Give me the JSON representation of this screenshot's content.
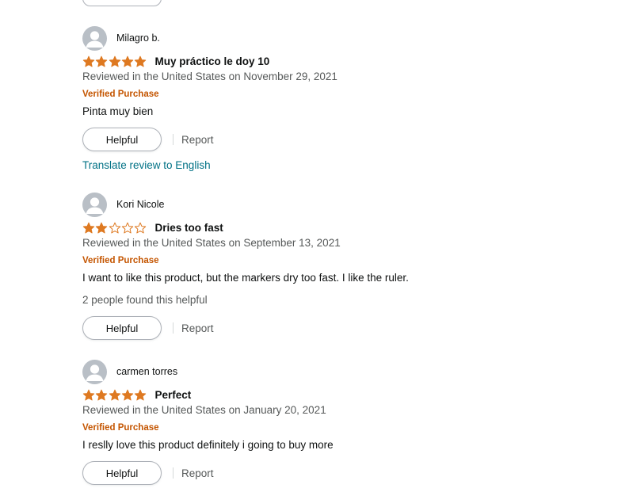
{
  "colors": {
    "star_filled": "#de7921",
    "star_empty_outline": "#de7921",
    "verified": "#c45500",
    "link": "#007185",
    "muted_text": "#565959",
    "avatar_bg": "#b9bfc6"
  },
  "reviews": [
    {
      "author": "Milagro b.",
      "rating": 5,
      "title": "Muy práctico le doy 10",
      "date": "Reviewed in the United States on November 29, 2021",
      "verified": "Verified Purchase",
      "body": "Pinta muy bien",
      "helpful_count_text": "",
      "helpful_label": "Helpful",
      "report_label": "Report",
      "translate_label": "Translate review to English"
    },
    {
      "author": "Kori Nicole",
      "rating": 2,
      "title": "Dries too fast",
      "date": "Reviewed in the United States on September 13, 2021",
      "verified": "Verified Purchase",
      "body": "I want to like this product, but the markers dry too fast. I like the ruler.",
      "helpful_count_text": "2 people found this helpful",
      "helpful_label": "Helpful",
      "report_label": "Report",
      "translate_label": ""
    },
    {
      "author": "carmen torres",
      "rating": 5,
      "title": "Perfect",
      "date": "Reviewed in the United States on January 20, 2021",
      "verified": "Verified Purchase",
      "body": "I reslly love this product definitely i going to buy more",
      "helpful_count_text": "",
      "helpful_label": "Helpful",
      "report_label": "Report",
      "translate_label": ""
    }
  ]
}
